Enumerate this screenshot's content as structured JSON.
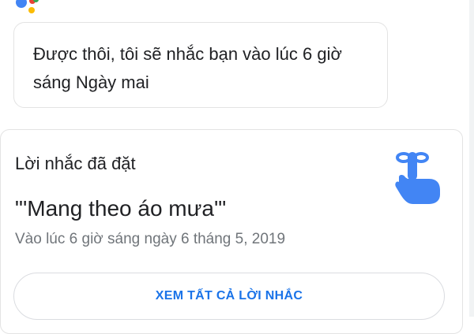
{
  "assistant": {
    "logo_icon": "google-assistant-logo",
    "colors": {
      "blue": "#4285F4",
      "red": "#EA4335",
      "yellow": "#FBBC05",
      "green": "#34A853"
    }
  },
  "assistant_reply": {
    "text": "Được thôi, tôi sẽ nhắc bạn vào lúc 6 giờ sáng Ngày mai"
  },
  "reminder_card": {
    "heading": "Lời nhắc đã đặt",
    "title": "\"'Mang theo áo mưa'\"",
    "time": "Vào lúc 6 giờ sáng ngày 6 tháng 5, 2019",
    "icon": "finger-with-string-reminder-icon",
    "icon_color": "#4285F4",
    "view_all_label": "XEM TẤT CẢ LỜI NHẮC",
    "accent_color": "#1A73E8"
  }
}
